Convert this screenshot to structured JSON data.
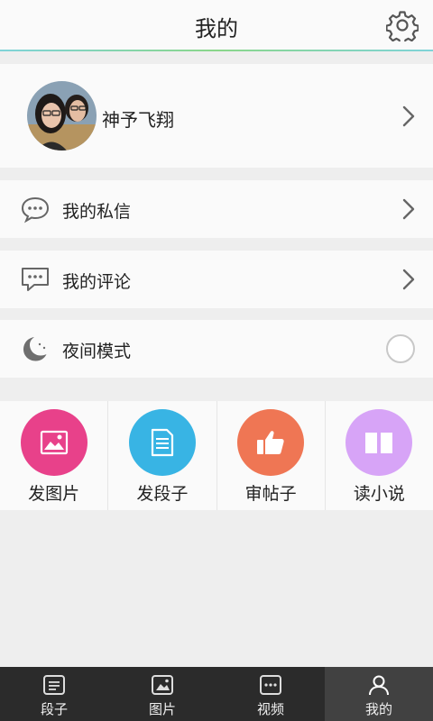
{
  "header": {
    "title": "我的",
    "settings_icon": "gear-icon"
  },
  "profile": {
    "name": "神予飞翔"
  },
  "menu": {
    "messages": {
      "label": "我的私信",
      "icon": "chat-bubble-icon"
    },
    "comments": {
      "label": "我的评论",
      "icon": "comment-icon"
    },
    "night_mode": {
      "label": "夜间模式",
      "icon": "moon-icon",
      "enabled": false
    }
  },
  "actions": [
    {
      "label": "发图片",
      "color": "#e8418a",
      "icon": "image-icon"
    },
    {
      "label": "发段子",
      "color": "#38b4e4",
      "icon": "document-icon"
    },
    {
      "label": "审帖子",
      "color": "#ef7654",
      "icon": "thumbs-up-icon"
    },
    {
      "label": "读小说",
      "color": "#d7a4f7",
      "icon": "book-icon"
    }
  ],
  "tabs": [
    {
      "label": "段子",
      "icon": "text-list-icon",
      "active": false
    },
    {
      "label": "图片",
      "icon": "image-tab-icon",
      "active": false
    },
    {
      "label": "视频",
      "icon": "video-icon",
      "active": false
    },
    {
      "label": "我的",
      "icon": "person-icon",
      "active": true
    }
  ]
}
